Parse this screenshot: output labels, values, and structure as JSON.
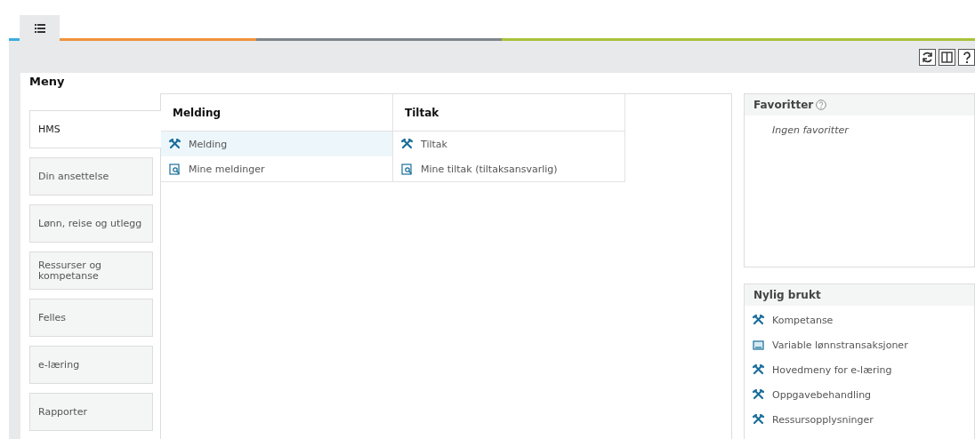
{
  "tabs": [
    {
      "kind": "list",
      "selected": true
    }
  ],
  "toolbar": {
    "buttons": [
      {
        "kind": "refresh"
      },
      {
        "kind": "columns"
      },
      {
        "kind": "help"
      }
    ]
  },
  "menu": {
    "title": "Meny",
    "categories": [
      {
        "label": "HMS",
        "selected": true
      },
      {
        "label": "Din ansettelse",
        "selected": false
      },
      {
        "label": "Lønn, reise og utlegg",
        "selected": false
      },
      {
        "label": "Ressurser og kompetanse",
        "selected": false
      },
      {
        "label": "Felles",
        "selected": false
      },
      {
        "label": "e-læring",
        "selected": false
      },
      {
        "label": "Rapporter",
        "selected": false
      }
    ],
    "columns": [
      {
        "title": "Melding",
        "items": [
          {
            "label": "Melding",
            "kind": "tools",
            "selected": true
          },
          {
            "label": "Mine meldinger",
            "kind": "report",
            "selected": false
          }
        ]
      },
      {
        "title": "Tiltak",
        "items": [
          {
            "label": "Tiltak",
            "kind": "tools",
            "selected": false
          },
          {
            "label": "Mine tiltak (tiltaksansvarlig)",
            "kind": "report",
            "selected": false
          }
        ]
      }
    ]
  },
  "favorites": {
    "title": "Favoritter",
    "empty_text": "Ingen favoritter"
  },
  "recent": {
    "title": "Nylig brukt",
    "items": [
      {
        "label": "Kompetanse",
        "kind": "tools"
      },
      {
        "label": "Variable lønnstransaksjoner",
        "kind": "form"
      },
      {
        "label": "Hovedmeny for e-læring",
        "kind": "tools"
      },
      {
        "label": "Oppgavebehandling",
        "kind": "tools"
      },
      {
        "label": "Ressursopplysninger",
        "kind": "tools"
      }
    ]
  }
}
